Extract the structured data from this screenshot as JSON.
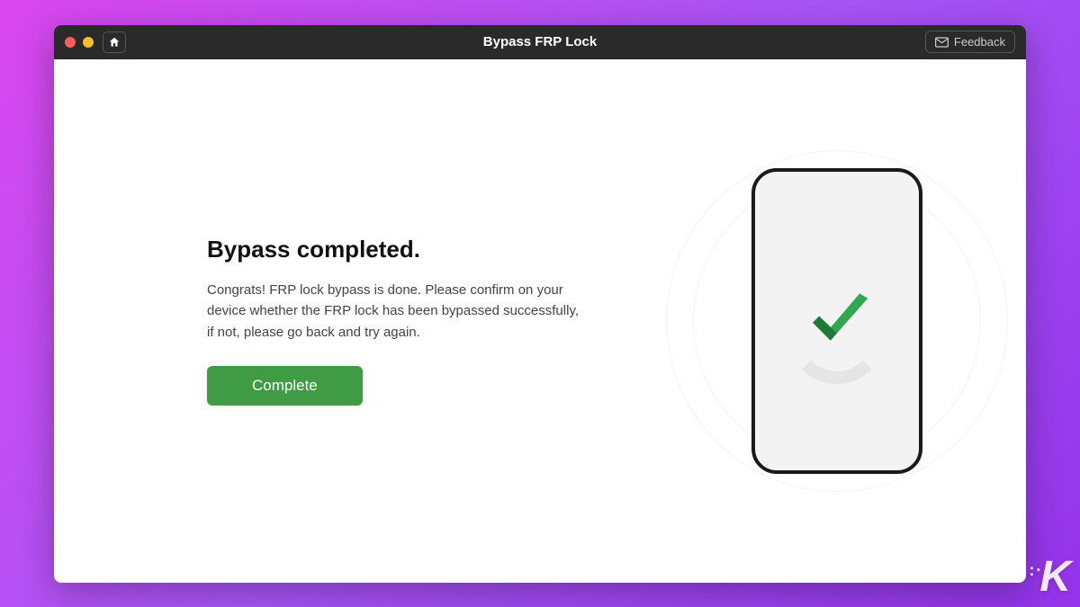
{
  "titlebar": {
    "title": "Bypass FRP Lock",
    "feedback_label": "Feedback"
  },
  "main": {
    "heading": "Bypass completed.",
    "description": "Congrats! FRP lock bypass is done. Please confirm on your device whether the FRP lock has been bypassed successfully, if not, please go back and try again.",
    "complete_button": "Complete"
  },
  "illustration": {
    "icon_name": "checkmark-icon"
  },
  "colors": {
    "accent_green": "#3f9b44",
    "titlebar_bg": "#2a2a2a"
  },
  "watermark": {
    "text": "K"
  }
}
